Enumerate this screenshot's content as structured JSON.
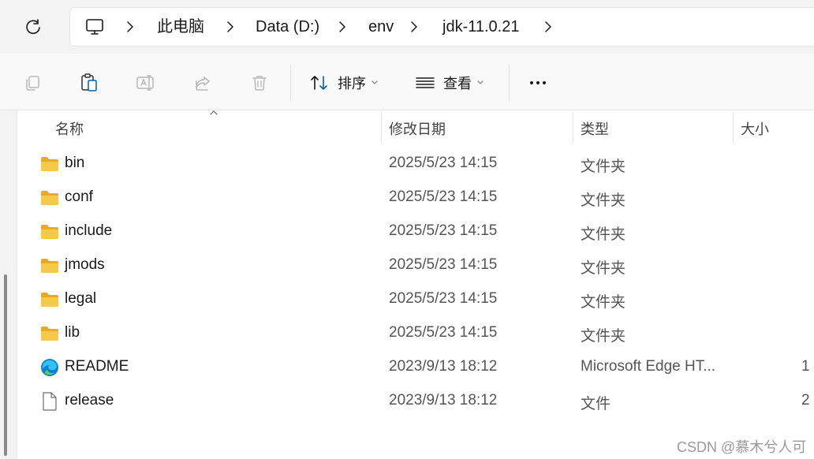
{
  "address_bar": {
    "breadcrumbs": [
      "此电脑",
      "Data (D:)",
      "env",
      "jdk-11.0.21"
    ]
  },
  "toolbar": {
    "sort_label": "排序",
    "view_label": "查看"
  },
  "columns": {
    "name": "名称",
    "date": "修改日期",
    "type": "类型",
    "size": "大小"
  },
  "files": [
    {
      "icon": "folder-icon",
      "name": "bin",
      "date": "2025/5/23 14:15",
      "type": "文件夹",
      "size": ""
    },
    {
      "icon": "folder-icon",
      "name": "conf",
      "date": "2025/5/23 14:15",
      "type": "文件夹",
      "size": ""
    },
    {
      "icon": "folder-icon",
      "name": "include",
      "date": "2025/5/23 14:15",
      "type": "文件夹",
      "size": ""
    },
    {
      "icon": "folder-icon",
      "name": "jmods",
      "date": "2025/5/23 14:15",
      "type": "文件夹",
      "size": ""
    },
    {
      "icon": "folder-icon",
      "name": "legal",
      "date": "2025/5/23 14:15",
      "type": "文件夹",
      "size": ""
    },
    {
      "icon": "folder-icon",
      "name": "lib",
      "date": "2025/5/23 14:15",
      "type": "文件夹",
      "size": ""
    },
    {
      "icon": "edge-html-icon",
      "name": "README",
      "date": "2023/9/13 18:12",
      "type": "Microsoft Edge HT...",
      "size": "1"
    },
    {
      "icon": "file-icon",
      "name": "release",
      "date": "2023/9/13 18:12",
      "type": "文件",
      "size": "2"
    }
  ],
  "watermark": "CSDN @慕木兮人可",
  "colors": {
    "folder": "#f7c948",
    "folder_dark": "#e8a925",
    "accent": "#005fb8"
  }
}
